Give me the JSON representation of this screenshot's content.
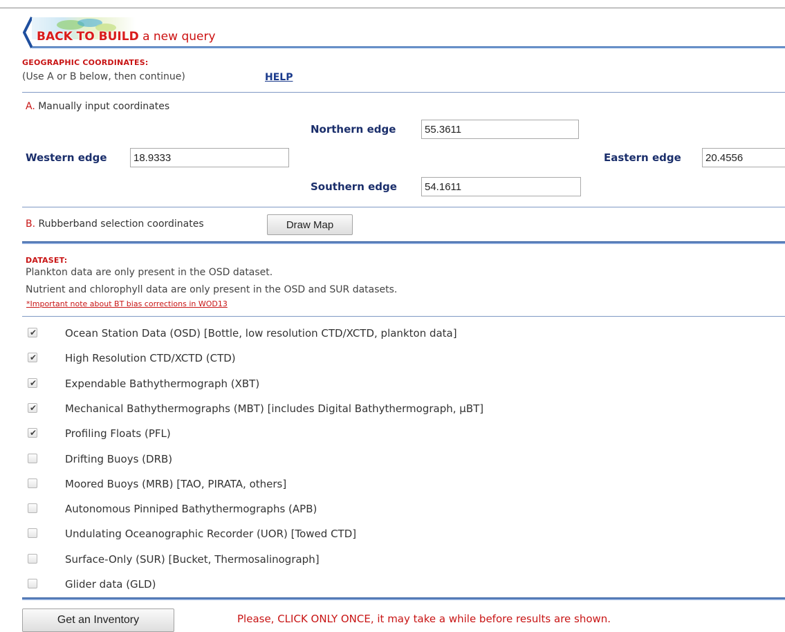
{
  "back": {
    "strong_label": "BACK TO BUILD",
    "rest_label": " a new query"
  },
  "geo": {
    "heading": "GEOGRAPHIC COORDINATES:",
    "note": "(Use A or B below, then continue)",
    "help_label": "HELP"
  },
  "manual": {
    "letter": "A.",
    "label": " Manually input coordinates",
    "northern_label": "Northern edge",
    "northern_value": "55.3611",
    "western_label": "Western edge",
    "western_value": "18.9333",
    "eastern_label": "Eastern edge",
    "eastern_value": "20.4556",
    "southern_label": "Southern edge",
    "southern_value": "54.1611"
  },
  "rubberband": {
    "letter": "B.",
    "label": " Rubberband selection coordinates",
    "draw_map_label": "Draw Map"
  },
  "dataset": {
    "heading": "DATASET:",
    "line1": "Plankton data are only present in the OSD dataset.",
    "line2": "Nutrient and chlorophyll data are only present in the OSD and SUR datasets.",
    "bt_note": "*Important note about BT bias corrections in WOD13",
    "items": [
      {
        "label": "Ocean Station Data (OSD) [Bottle, low resolution CTD/XCTD, plankton data]",
        "checked": true
      },
      {
        "label": "High Resolution CTD/XCTD (CTD)",
        "checked": true
      },
      {
        "label": "Expendable Bathythermograph (XBT)",
        "checked": true
      },
      {
        "label": "Mechanical Bathythermographs (MBT) [includes Digital Bathythermograph, μBT]",
        "checked": true
      },
      {
        "label": "Profiling Floats (PFL)",
        "checked": true
      },
      {
        "label": "Drifting Buoys (DRB)",
        "checked": false
      },
      {
        "label": "Moored Buoys (MRB) [TAO, PIRATA, others]",
        "checked": false
      },
      {
        "label": "Autonomous Pinniped Bathythermographs (APB)",
        "checked": false
      },
      {
        "label": "Undulating Oceanographic Recorder (UOR) [Towed CTD]",
        "checked": false
      },
      {
        "label": "Surface-Only (SUR) [Bucket, Thermosalinograph]",
        "checked": false
      },
      {
        "label": "Glider data (GLD)",
        "checked": false
      }
    ]
  },
  "footer": {
    "inventory_label": "Get an Inventory",
    "warning": "Please, CLICK ONLY ONCE, it may take a while before results are shown."
  },
  "colors": {
    "accent_red": "#c81414",
    "link_blue": "#1a3a8c",
    "edge_label_navy": "#1a2e6b",
    "rule_blue": "#234f93"
  },
  "icons": {
    "back": "chevron-left-icon",
    "checkbox": "checkmark-icon"
  }
}
